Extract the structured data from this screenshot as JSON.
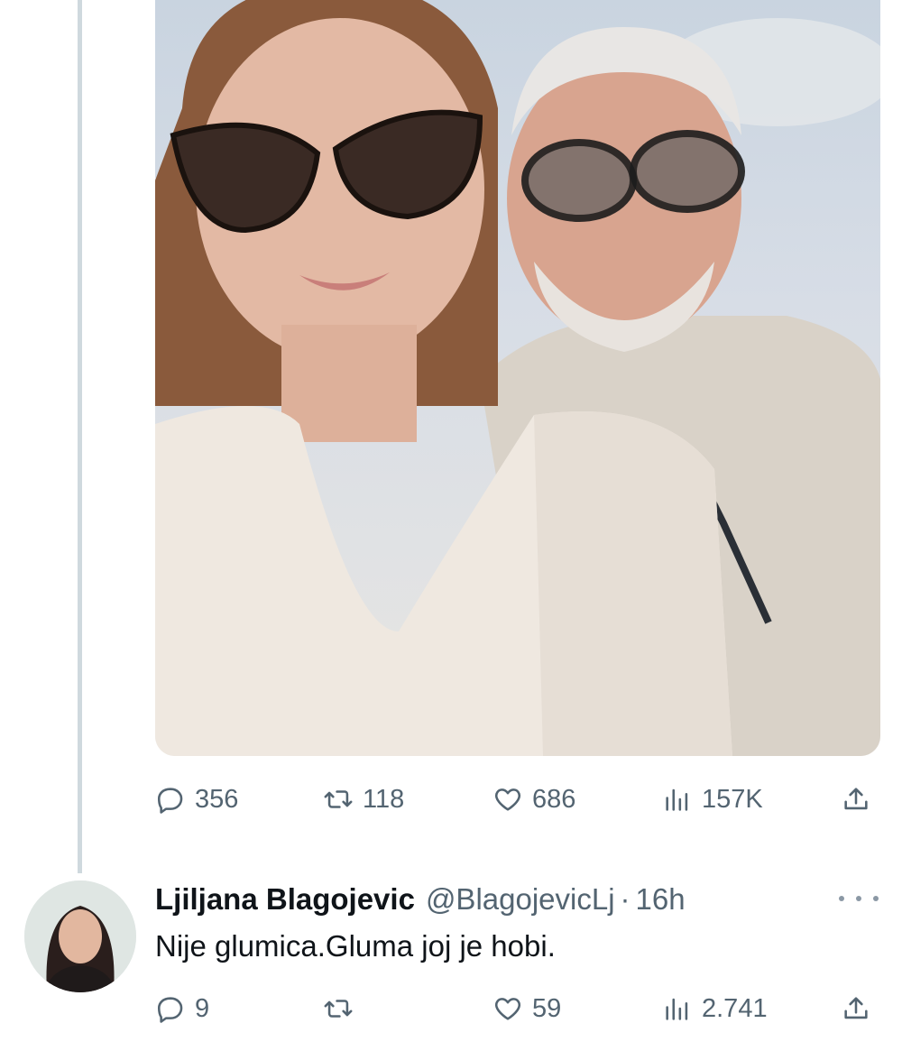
{
  "tweet": {
    "stats": {
      "replies": "356",
      "reposts": "118",
      "likes": "686",
      "views": "157K"
    }
  },
  "reply": {
    "author_name": "Ljiljana Blagojevic",
    "author_handle": "@BlagojevicLj",
    "separator": "·",
    "time": "16h",
    "text": "Nije glumica.Gluma joj je hobi.",
    "stats": {
      "replies": "9",
      "reposts": "",
      "likes": "59",
      "views": "2.741"
    }
  },
  "colors": {
    "thread_line": "#cfd9de",
    "muted_text": "#536471",
    "primary_text": "#0f1419"
  },
  "icons": [
    "reply-icon",
    "repost-icon",
    "like-icon",
    "views-icon",
    "share-icon",
    "more-icon"
  ]
}
